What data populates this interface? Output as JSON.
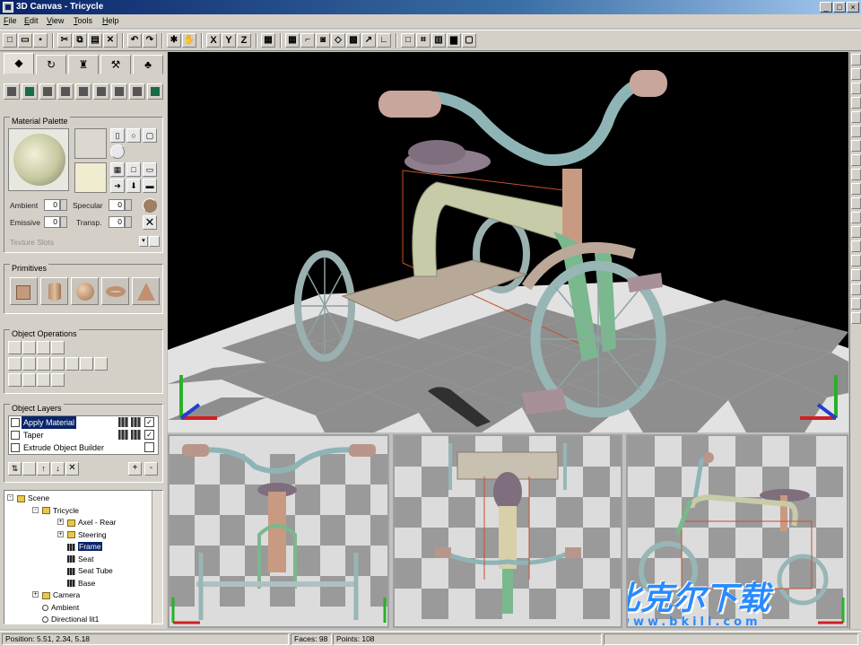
{
  "window": {
    "title": "3D Canvas - Tricycle",
    "buttons": [
      "_",
      "□",
      "×"
    ]
  },
  "menu": [
    "File",
    "Edit",
    "View",
    "Tools",
    "Help"
  ],
  "toolbar": {
    "axes": [
      "X",
      "Y",
      "Z"
    ]
  },
  "left_panel": {
    "material_palette": {
      "title": "Material Palette",
      "ambient_label": "Ambient",
      "ambient_value": "0",
      "specular_label": "Specular",
      "specular_value": "0",
      "emissive_label": "Emissive",
      "emissive_value": "0",
      "transp_label": "Transp.",
      "transp_value": "0",
      "texture_label": "Texture Slots"
    },
    "primitives": {
      "title": "Primitives"
    },
    "object_operations": {
      "title": "Object Operations"
    },
    "object_layers": {
      "title": "Object Layers",
      "rows": [
        {
          "label": "Apply Material",
          "selected": true,
          "checked": true
        },
        {
          "label": "Taper",
          "selected": false,
          "checked": true
        },
        {
          "label": "Extrude Object Builder",
          "selected": false,
          "checked": false
        }
      ]
    },
    "scene_tree": [
      {
        "label": "Scene",
        "depth": 0,
        "icon": "folder",
        "expand": "-"
      },
      {
        "label": "Tricycle",
        "depth": 1,
        "icon": "folder",
        "expand": "-"
      },
      {
        "label": "Axel - Rear",
        "depth": 2,
        "icon": "folder",
        "expand": "+"
      },
      {
        "label": "Steering",
        "depth": 2,
        "icon": "folder",
        "expand": "+"
      },
      {
        "label": "Frame",
        "depth": 2,
        "icon": "obj",
        "selected": true
      },
      {
        "label": "Seat",
        "depth": 2,
        "icon": "obj"
      },
      {
        "label": "Seat Tube",
        "depth": 2,
        "icon": "obj"
      },
      {
        "label": "Base",
        "depth": 2,
        "icon": "obj"
      },
      {
        "label": "Camera",
        "depth": 1,
        "icon": "folder",
        "expand": "+"
      },
      {
        "label": "Ambient",
        "depth": 1,
        "icon": "light"
      },
      {
        "label": "Directional lit1",
        "depth": 1,
        "icon": "light"
      }
    ]
  },
  "status": {
    "position": "Position: 5.51, 2.34, 5.18",
    "faces": "Faces: 98",
    "points": "Points: 108"
  },
  "watermark": {
    "text": "比克尔下载",
    "url": "www.bkill.com"
  },
  "colors": {
    "title_bar": "#0a246a",
    "selection": "#0a246a",
    "panel": "#d4d0c8",
    "viewport_bg": "#000000"
  }
}
